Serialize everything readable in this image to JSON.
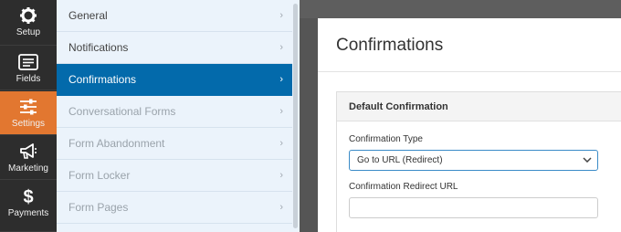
{
  "rail": {
    "items": [
      {
        "label": "Setup",
        "icon": "gear-icon"
      },
      {
        "label": "Fields",
        "icon": "fields-icon"
      },
      {
        "label": "Settings",
        "icon": "sliders-icon",
        "active": true
      },
      {
        "label": "Marketing",
        "icon": "megaphone-icon"
      },
      {
        "label": "Payments",
        "icon": "dollar-icon"
      }
    ],
    "active_color": "#e27730"
  },
  "submenu": {
    "items": [
      {
        "label": "General"
      },
      {
        "label": "Notifications"
      },
      {
        "label": "Confirmations",
        "active": true
      },
      {
        "label": "Conversational Forms",
        "disabled": true
      },
      {
        "label": "Form Abandonment",
        "disabled": true
      },
      {
        "label": "Form Locker",
        "disabled": true
      },
      {
        "label": "Form Pages",
        "disabled": true
      }
    ],
    "active_color": "#036aab"
  },
  "main": {
    "title": "Confirmations",
    "card": {
      "heading": "Default Confirmation",
      "type_label": "Confirmation Type",
      "type_value": "Go to URL (Redirect)",
      "redirect_label": "Confirmation Redirect URL",
      "redirect_value": ""
    }
  }
}
